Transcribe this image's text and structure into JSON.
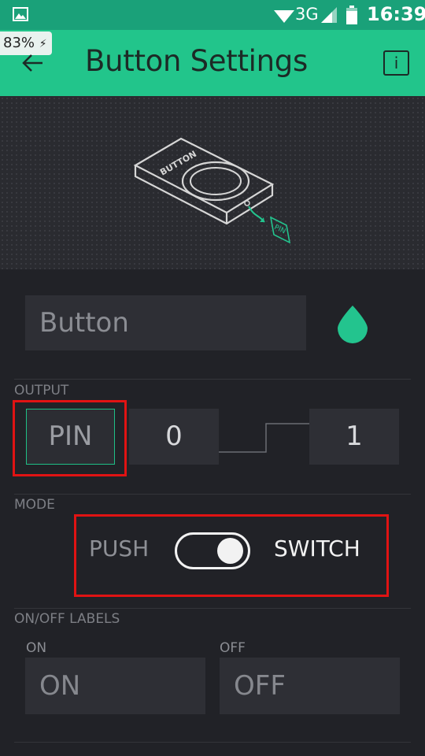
{
  "status_bar": {
    "network": "3G",
    "time": "16:39",
    "battery_badge": "83%"
  },
  "header": {
    "title": "Button Settings",
    "info_label": "i"
  },
  "preview": {
    "device_label": "BUTTON",
    "pin_label": "PIN"
  },
  "widget": {
    "name_value": "Button",
    "color": "#23c48e"
  },
  "output": {
    "section_label": "OUTPUT",
    "pin_label": "PIN",
    "min_value": "0",
    "max_value": "1"
  },
  "mode": {
    "section_label": "MODE",
    "push_label": "PUSH",
    "switch_label": "SWITCH",
    "selected": "SWITCH"
  },
  "onoff": {
    "section_label": "ON/OFF LABELS",
    "on_caption": "ON",
    "off_caption": "OFF",
    "on_value": "ON",
    "off_value": "OFF"
  },
  "colors": {
    "accent": "#23c48e",
    "highlight": "#e01313",
    "background": "#212227"
  }
}
